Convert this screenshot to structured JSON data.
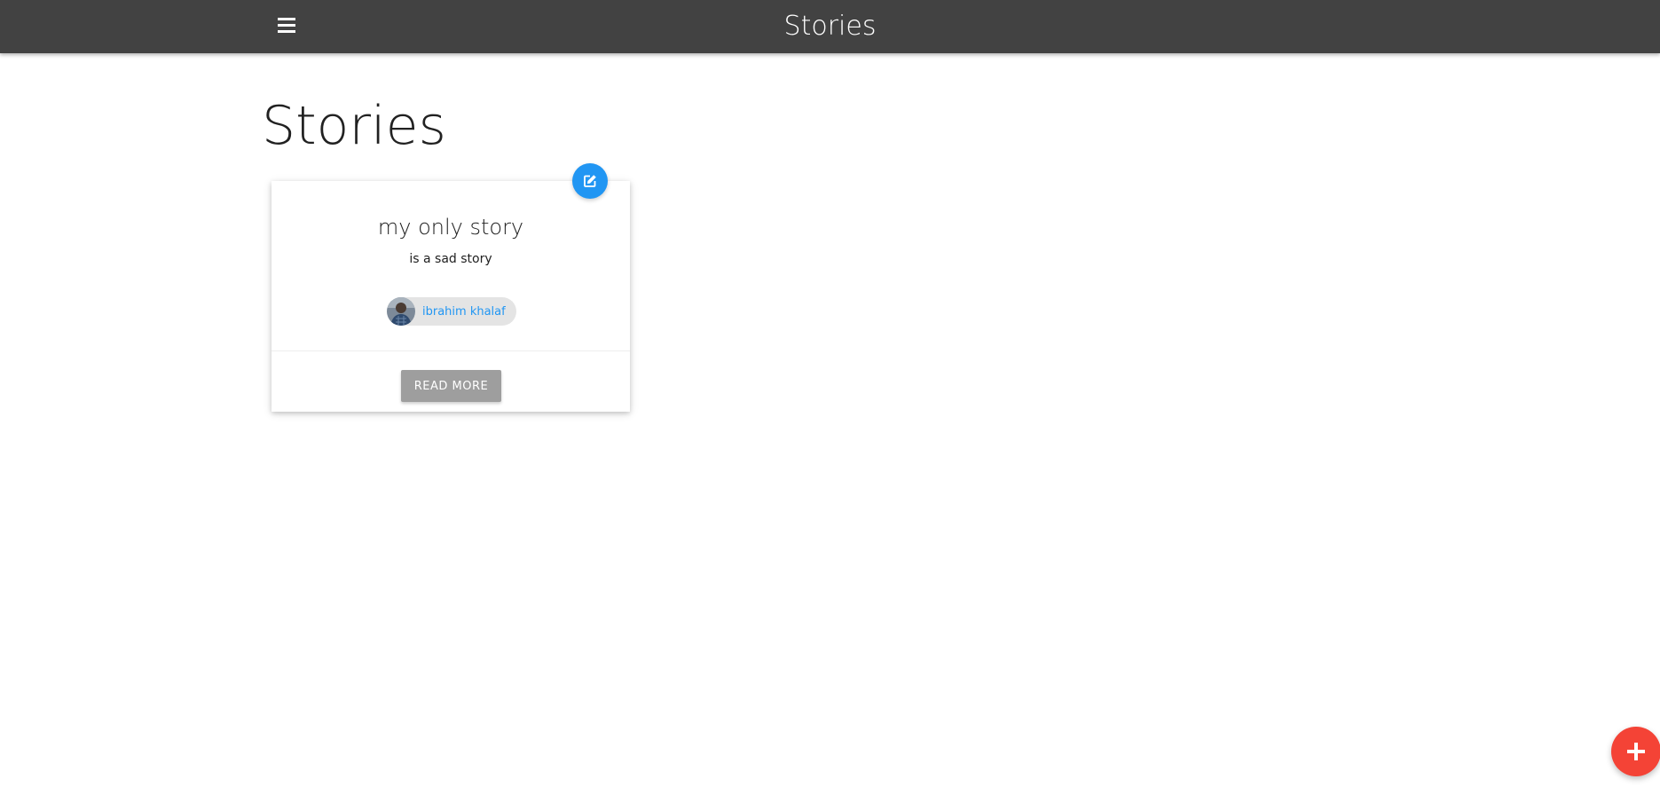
{
  "navbar": {
    "title": "Stories",
    "menu_icon": "hamburger-menu-icon"
  },
  "page": {
    "heading": "Stories"
  },
  "stories": [
    {
      "title": "my only story",
      "subtitle": "is a sad story",
      "author": {
        "name": "ibrahim khalaf",
        "avatar": "author-avatar"
      },
      "read_more_label": "READ MORE",
      "edit_icon": "edit-icon"
    }
  ],
  "fab": {
    "icon": "plus-icon"
  },
  "colors": {
    "navbar": "#424242",
    "edit_fab": "#2196f3",
    "add_fab": "#f44336",
    "chip_text": "#2196f3",
    "read_more_button": "#9e9e9e"
  }
}
